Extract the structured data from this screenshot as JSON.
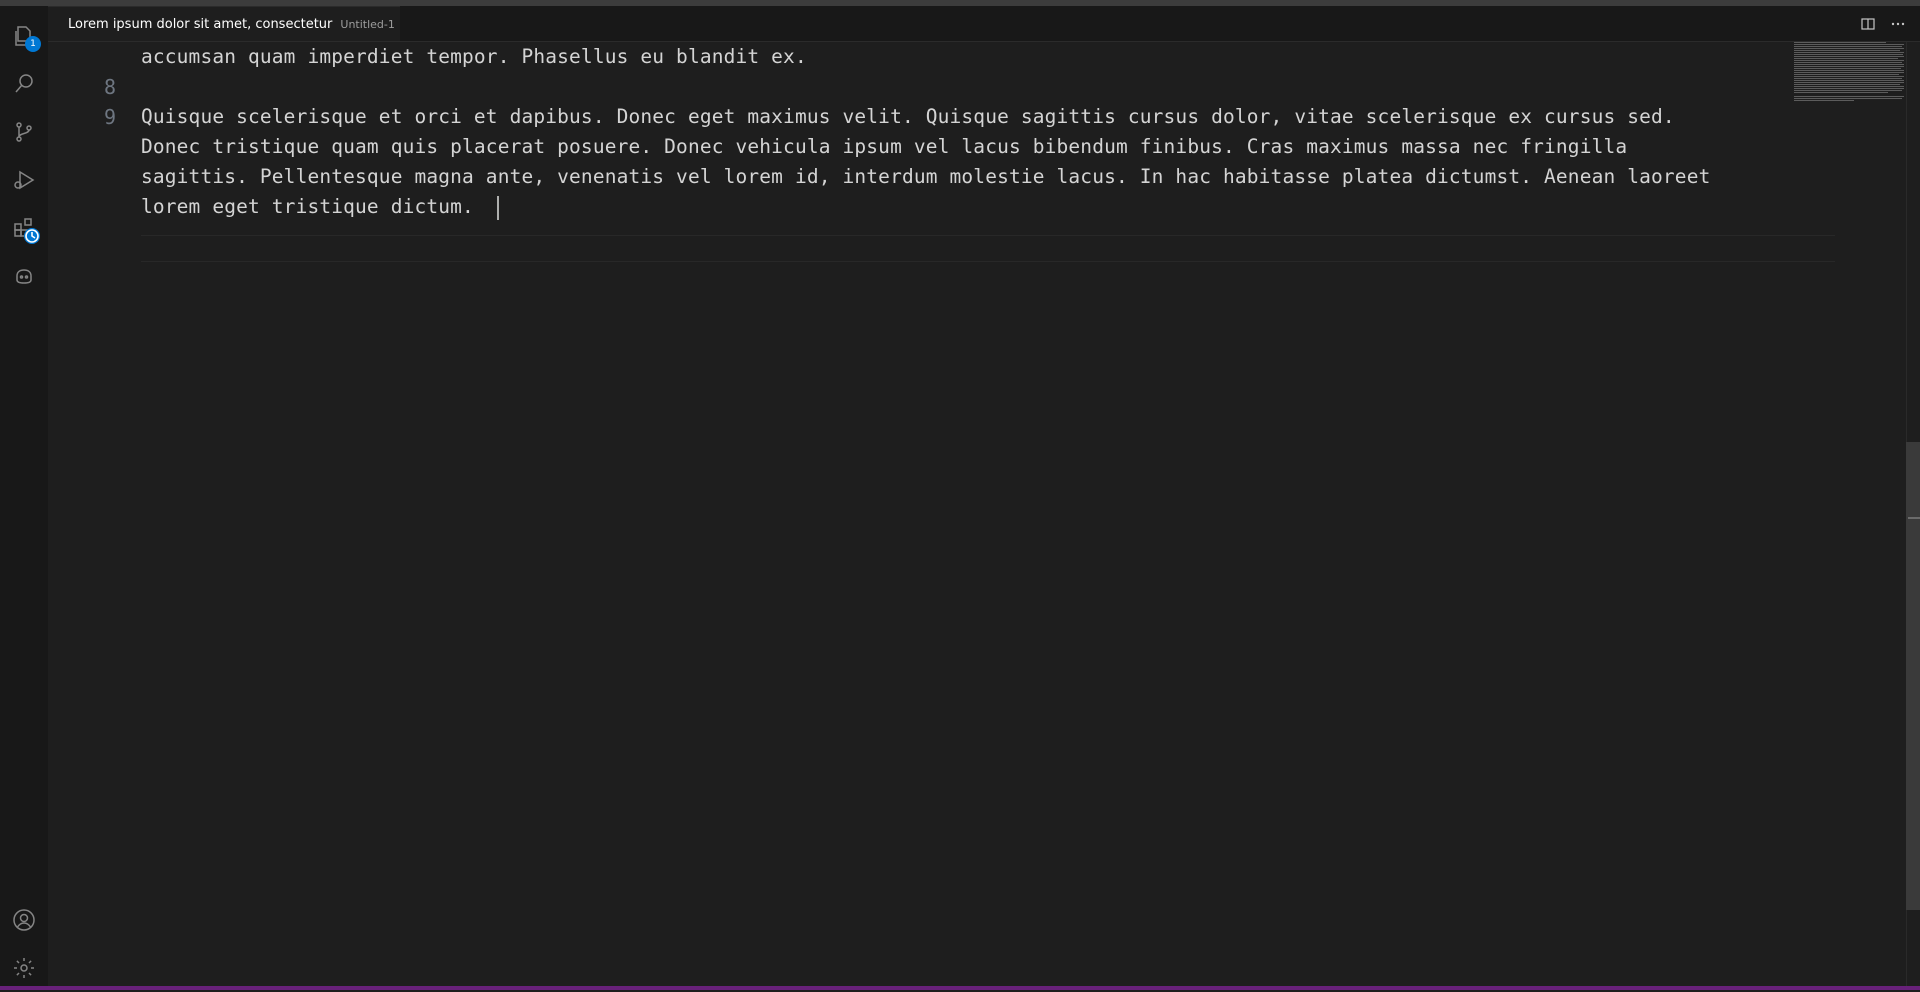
{
  "activity_bar": {
    "explorer_badge": "1",
    "items": [
      "explorer-icon",
      "search-icon",
      "source-control-icon",
      "run-debug-icon",
      "extensions-icon",
      "copilot-icon"
    ],
    "bottom_items": [
      "account-icon",
      "settings-gear-icon"
    ]
  },
  "tab": {
    "title": "Lorem ipsum dolor sit amet, consectetur",
    "description": "Untitled-1",
    "unsaved_indicator": "dirty-dot-icon"
  },
  "editor": {
    "lines": [
      {
        "number": "",
        "text": "accumsan quam imperdiet tempor. Phasellus eu blandit ex."
      },
      {
        "number": "8",
        "text": ""
      },
      {
        "number": "9",
        "text": "Quisque scelerisque et orci et dapibus. Donec eget maximus velit. Quisque sagittis cursus dolor, vitae scelerisque ex cursus sed."
      },
      {
        "number": "",
        "text": "Donec tristique quam quis placerat posuere. Donec vehicula ipsum vel lacus bibendum finibus. Cras maximus massa nec fringilla"
      },
      {
        "number": "",
        "text": "sagittis. Pellentesque magna ante, venenatis vel lorem id, interdum molestie lacus. In hac habitasse platea dictumst. Aenean laoreet"
      },
      {
        "number": "",
        "text": "lorem eget tristique dictum. "
      }
    ]
  },
  "colors": {
    "accent": "#0078d4",
    "statusbar": "#68217a",
    "editor_bg": "#1e1e1e"
  }
}
